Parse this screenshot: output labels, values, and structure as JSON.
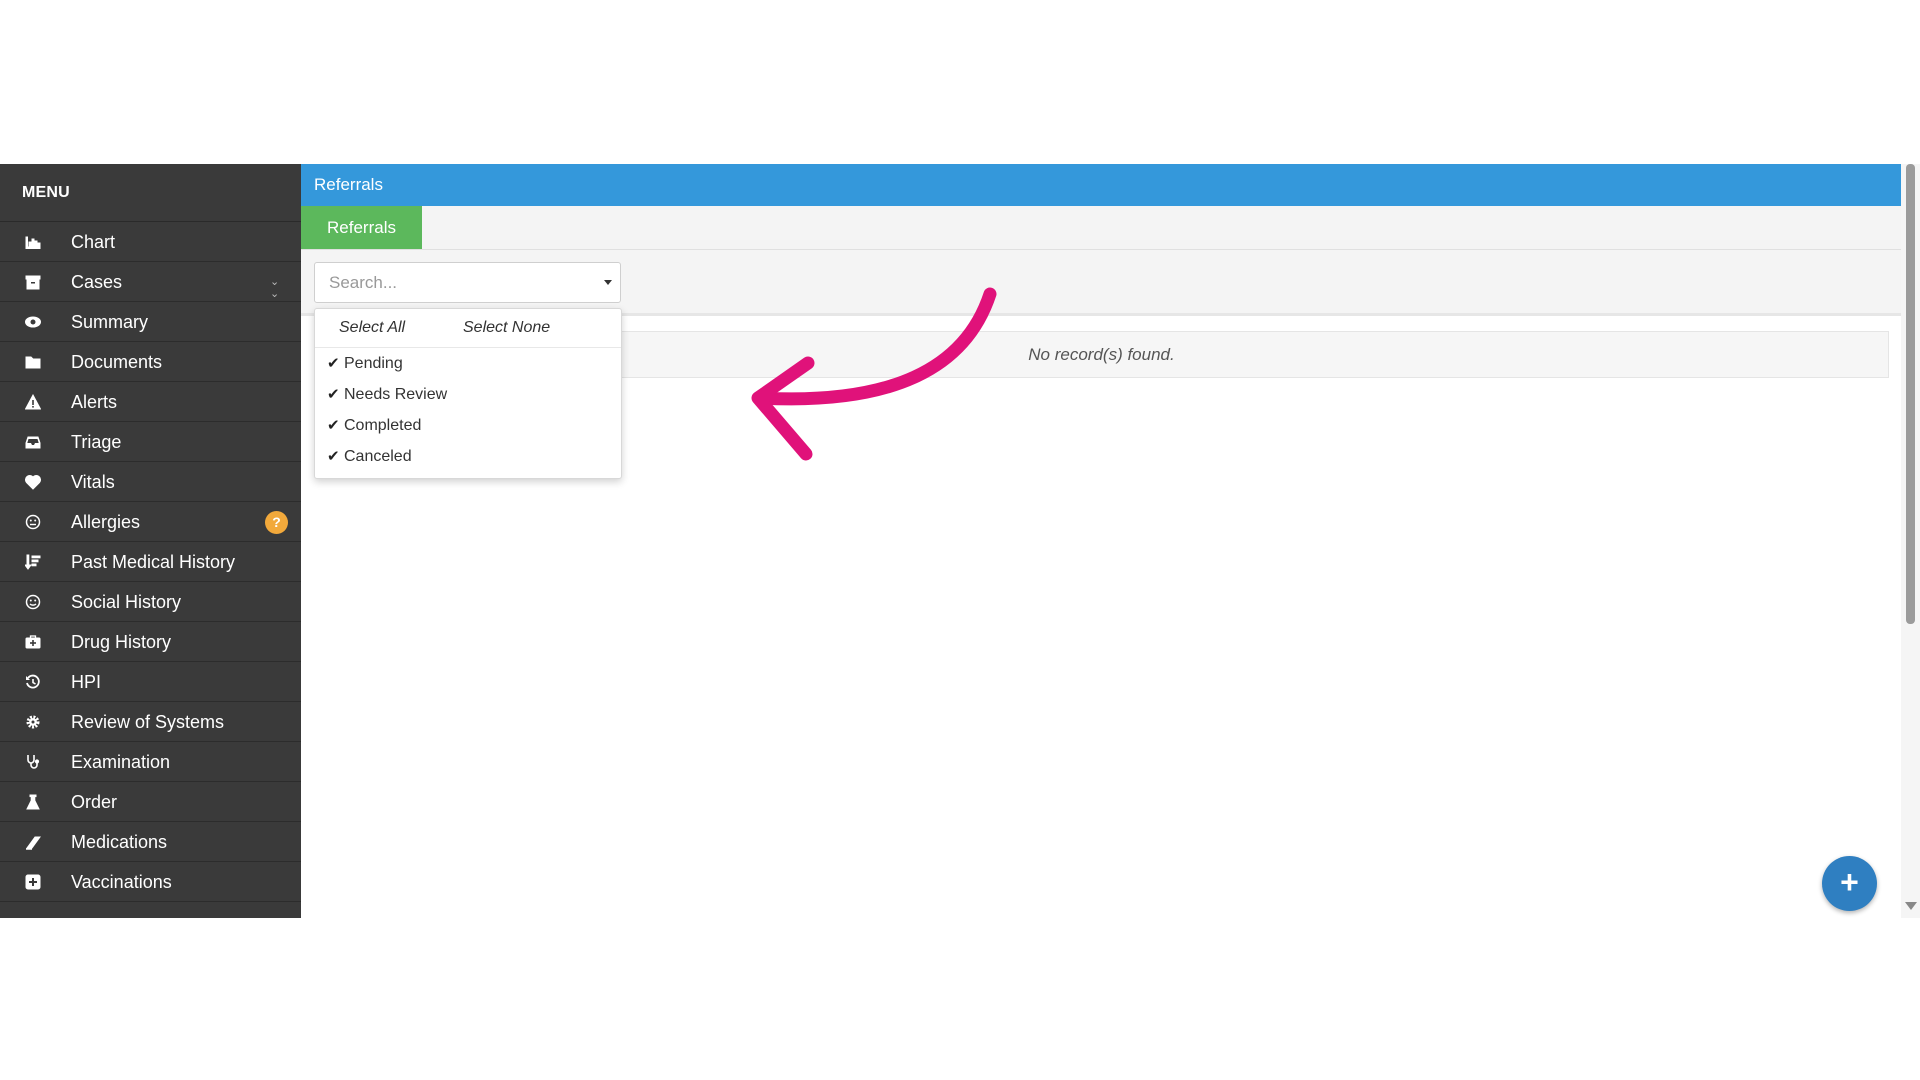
{
  "sidebar": {
    "title": "MENU",
    "items": [
      {
        "label": "Chart",
        "icon": "bar-chart-icon"
      },
      {
        "label": "Cases",
        "icon": "archive-icon",
        "chevron": "»"
      },
      {
        "label": "Summary",
        "icon": "eye-icon"
      },
      {
        "label": "Documents",
        "icon": "folder-icon"
      },
      {
        "label": "Alerts",
        "icon": "warning-icon"
      },
      {
        "label": "Triage",
        "icon": "inbox-icon"
      },
      {
        "label": "Vitals",
        "icon": "heart-icon"
      },
      {
        "label": "Allergies",
        "icon": "face-icon",
        "badge": "?"
      },
      {
        "label": "Past Medical History",
        "icon": "sort-list-icon"
      },
      {
        "label": "Social History",
        "icon": "smile-icon"
      },
      {
        "label": "Drug History",
        "icon": "medkit-icon"
      },
      {
        "label": "HPI",
        "icon": "history-icon"
      },
      {
        "label": "Review of Systems",
        "icon": "gear-icon"
      },
      {
        "label": "Examination",
        "icon": "stethoscope-icon"
      },
      {
        "label": "Order",
        "icon": "flask-icon"
      },
      {
        "label": "Medications",
        "icon": "pill-icon"
      },
      {
        "label": "Vaccinations",
        "icon": "plus-square-icon"
      }
    ]
  },
  "header": {
    "title": "Referrals"
  },
  "tabs": [
    {
      "label": "Referrals",
      "active": true
    }
  ],
  "filter": {
    "placeholder": "Search...",
    "dropdown": {
      "select_all": "Select All",
      "select_none": "Select None",
      "options": [
        {
          "label": "Pending",
          "checked": true
        },
        {
          "label": "Needs Review",
          "checked": true
        },
        {
          "label": "Completed",
          "checked": true
        },
        {
          "label": "Canceled",
          "checked": true
        }
      ]
    }
  },
  "results": {
    "empty_text": "No record(s) found."
  },
  "fab": {
    "label": "+"
  },
  "colors": {
    "sidebar_bg": "#3a3a3a",
    "header_blue": "#3498db",
    "tab_green": "#5cb85c",
    "badge_orange": "#f2a93b",
    "fab_blue": "#2f7fc1",
    "annotation_pink": "#e0127a"
  }
}
